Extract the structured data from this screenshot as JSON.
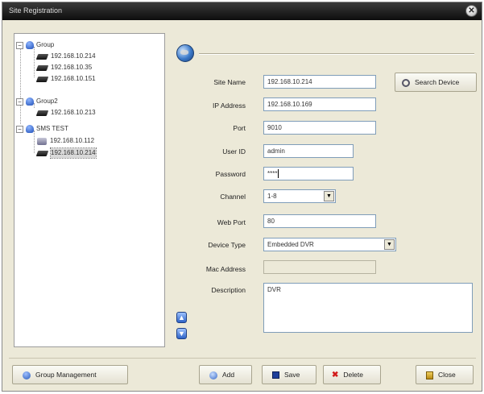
{
  "window": {
    "title": "Site Registration"
  },
  "tree": {
    "groups": [
      {
        "label": "Group",
        "devices": [
          "192.168.10.214",
          "192.168.10.35",
          "192.168.10.151"
        ]
      },
      {
        "label": "Group2",
        "devices": [
          "192.168.10.213"
        ]
      },
      {
        "label": "SMS TEST",
        "devices": [
          "192.168.10.112",
          "192.168.10.214"
        ]
      }
    ]
  },
  "form": {
    "site_name_label": "Site Name",
    "site_name_value": "192.168.10.214",
    "ip_address_label": "IP Address",
    "ip_address_value": "192.168.10.169",
    "port_label": "Port",
    "port_value": "9010",
    "user_id_label": "User ID",
    "user_id_value": "admin",
    "password_label": "Password",
    "password_value": "****",
    "channel_label": "Channel",
    "channel_value": "1-8",
    "web_port_label": "Web Port",
    "web_port_value": "80",
    "device_type_label": "Device Type",
    "device_type_value": "Embedded DVR",
    "mac_address_label": "Mac Address",
    "mac_address_value": "",
    "description_label": "Description",
    "description_value": "DVR"
  },
  "buttons": {
    "search_device": "Search Device",
    "group_management": "Group Management",
    "add": "Add",
    "save": "Save",
    "delete": "Delete",
    "close": "Close"
  }
}
